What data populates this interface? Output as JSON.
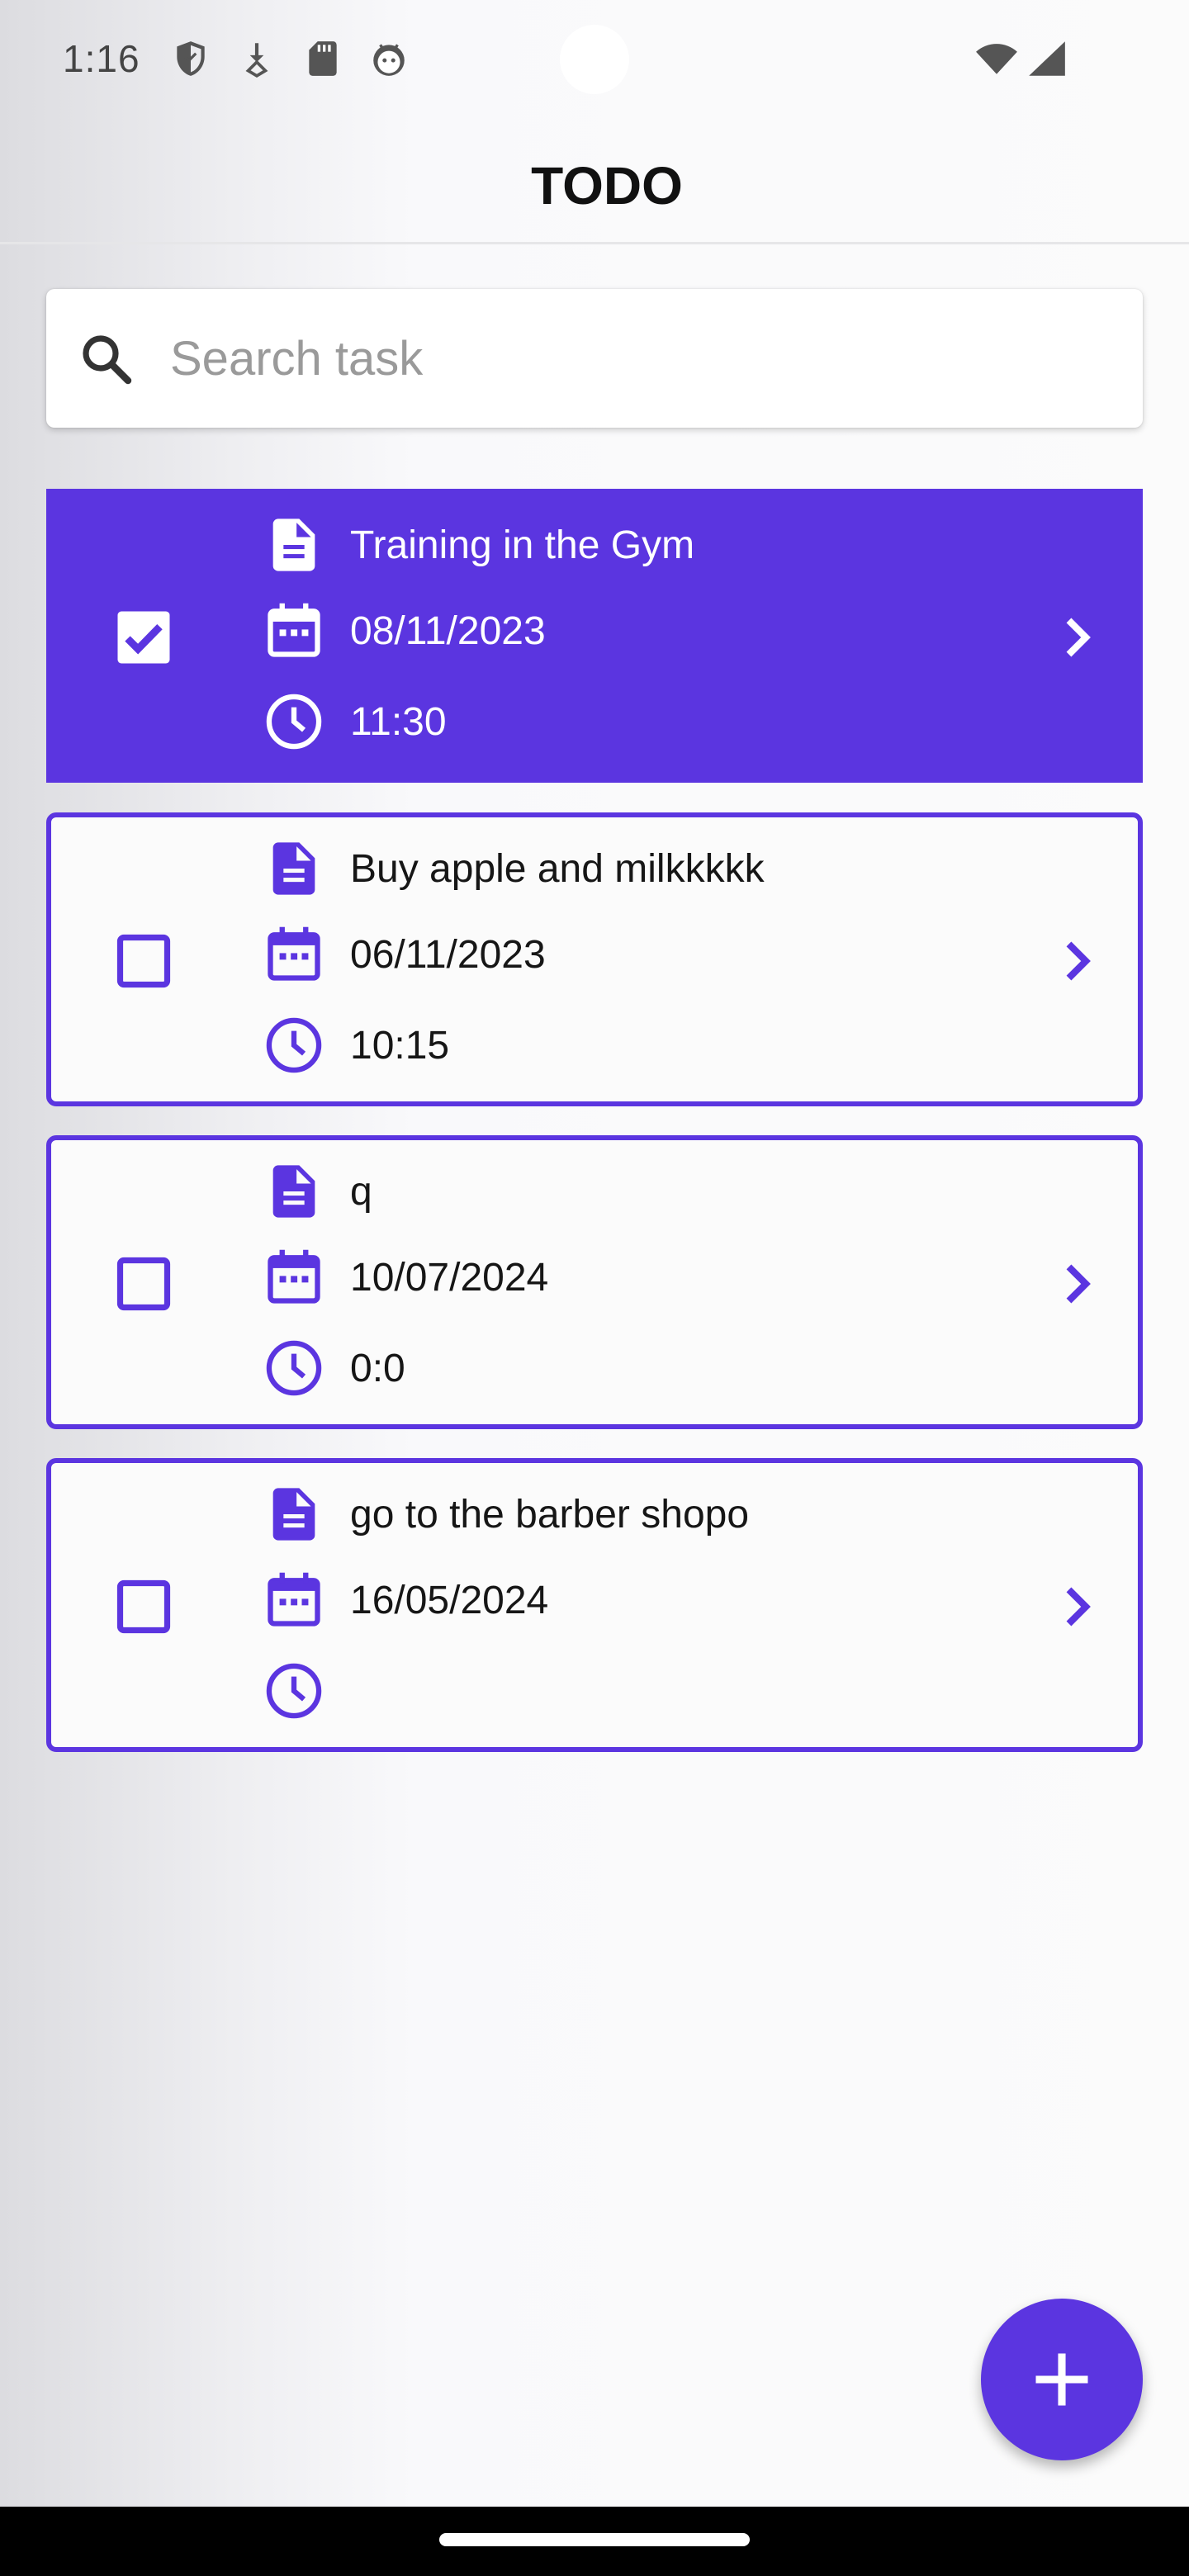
{
  "status_bar": {
    "time": "1:16",
    "icons": [
      "shield-icon",
      "download-icon",
      "sd-card-icon",
      "android-debug-icon"
    ],
    "right_icons": [
      "wifi-icon",
      "cell-signal-icon"
    ]
  },
  "app_bar": {
    "title": "TODO"
  },
  "search": {
    "placeholder": "Search task",
    "value": ""
  },
  "colors": {
    "accent": "#5b35e0",
    "text": "#161616",
    "done_text": "#ffffff"
  },
  "tasks": [
    {
      "title": "Training in the Gym",
      "date": "08/11/2023",
      "time": "11:30",
      "done": true
    },
    {
      "title": "Buy apple and milkkkkk",
      "date": "06/11/2023",
      "time": "10:15",
      "done": false
    },
    {
      "title": "q",
      "date": "10/07/2024",
      "time": "0:0",
      "done": false
    },
    {
      "title": "go to the barber shopo",
      "date": "16/05/2024",
      "time": "",
      "done": false
    }
  ],
  "fab": {
    "icon": "plus-icon"
  }
}
